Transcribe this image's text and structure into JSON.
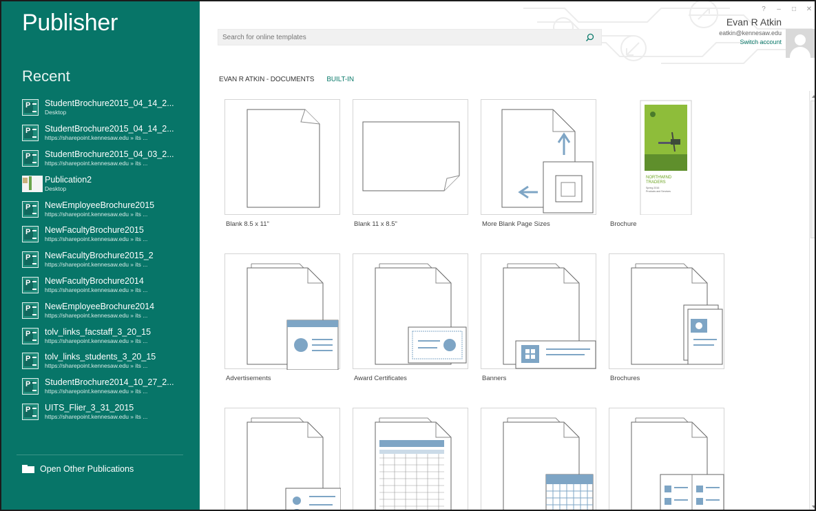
{
  "sidebar": {
    "app_title": "Publisher",
    "recent_heading": "Recent",
    "recent_items": [
      {
        "name": "StudentBrochure2015_04_14_2...",
        "path": "Desktop",
        "icon": "publisher-file-icon"
      },
      {
        "name": "StudentBrochure2015_04_14_2...",
        "path": "https://sharepoint.kennesaw.edu » its ...",
        "icon": "publisher-file-icon"
      },
      {
        "name": "StudentBrochure2015_04_03_2...",
        "path": "https://sharepoint.kennesaw.edu » its ...",
        "icon": "publisher-file-icon"
      },
      {
        "name": "Publication2",
        "path": "Desktop",
        "icon": "publication-thumbnail-icon"
      },
      {
        "name": "NewEmployeeBrochure2015",
        "path": "https://sharepoint.kennesaw.edu » its ...",
        "icon": "publisher-file-icon"
      },
      {
        "name": "NewFacultyBrochure2015",
        "path": "https://sharepoint.kennesaw.edu » its ...",
        "icon": "publisher-file-icon"
      },
      {
        "name": "NewFacultyBrochure2015_2",
        "path": "https://sharepoint.kennesaw.edu » its ...",
        "icon": "publisher-file-icon"
      },
      {
        "name": "NewFacultyBrochure2014",
        "path": "https://sharepoint.kennesaw.edu » its ...",
        "icon": "publisher-file-icon"
      },
      {
        "name": "NewEmployeeBrochure2014",
        "path": "https://sharepoint.kennesaw.edu » its ...",
        "icon": "publisher-file-icon"
      },
      {
        "name": "tolv_links_facstaff_3_20_15",
        "path": "https://sharepoint.kennesaw.edu » its ...",
        "icon": "publisher-file-icon"
      },
      {
        "name": "tolv_links_students_3_20_15",
        "path": "https://sharepoint.kennesaw.edu » its ...",
        "icon": "publisher-file-icon"
      },
      {
        "name": "StudentBrochure2014_10_27_2...",
        "path": "https://sharepoint.kennesaw.edu » its ...",
        "icon": "publisher-file-icon"
      },
      {
        "name": "UITS_Flier_3_31_2015",
        "path": "https://sharepoint.kennesaw.edu » its ...",
        "icon": "publisher-file-icon"
      }
    ],
    "open_other_label": "Open Other Publications"
  },
  "header": {
    "search_placeholder": "Search for online templates",
    "user_name": "Evan R Atkin",
    "user_email": "eatkin@kennesaw.edu",
    "switch_account": "Switch account",
    "window_controls": [
      "?",
      "–",
      "□",
      "✕"
    ]
  },
  "tabs": [
    {
      "label": "EVAN R ATKIN - DOCUMENTS",
      "active": false
    },
    {
      "label": "BUILT-IN",
      "active": true
    }
  ],
  "templates": [
    {
      "label": "Blank 8.5 x 11\"",
      "kind": "blank-portrait"
    },
    {
      "label": "Blank 11 x 8.5\"",
      "kind": "blank-landscape"
    },
    {
      "label": "More Blank Page Sizes",
      "kind": "more-sizes"
    },
    {
      "label": "Brochure",
      "kind": "brochure-preview"
    },
    {
      "label": "Advertisements",
      "kind": "advertisements"
    },
    {
      "label": "Award Certificates",
      "kind": "award-certificates"
    },
    {
      "label": "Banners",
      "kind": "banners"
    },
    {
      "label": "Brochures",
      "kind": "brochures"
    },
    {
      "label": "",
      "kind": "business-cards"
    },
    {
      "label": "",
      "kind": "business-forms"
    },
    {
      "label": "",
      "kind": "calendars"
    },
    {
      "label": "",
      "kind": "catalogs"
    }
  ],
  "brochure_preview": {
    "title_line1": "NORTHWIND",
    "title_line2": "TRADERS",
    "sub1": "Spring 2016",
    "sub2": "Products and Services"
  },
  "colors": {
    "sidebar": "#077568",
    "accent": "#0b7a6b",
    "icon_blue": "#7ea5c5"
  }
}
